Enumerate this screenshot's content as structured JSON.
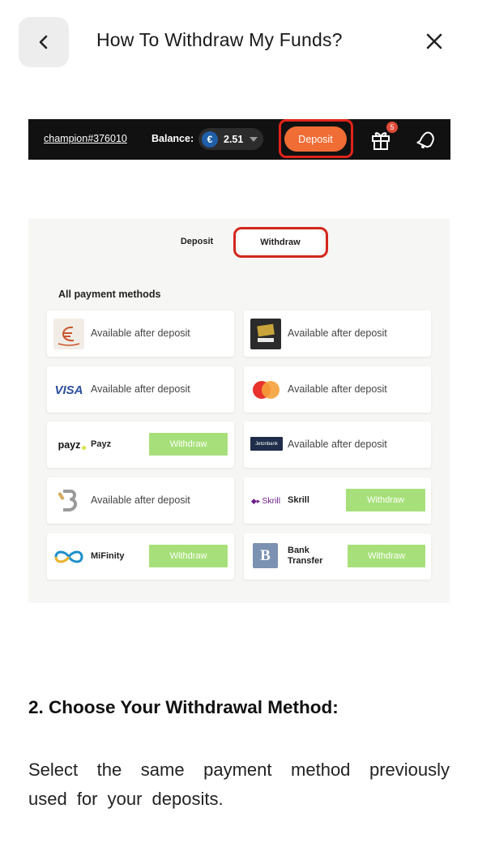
{
  "header": {
    "title": "How To Withdraw My Funds?"
  },
  "site_header": {
    "username": "champion#376010",
    "balance_label": "Balance:",
    "currency_symbol": "€",
    "balance_value": "2.51",
    "deposit_label": "Deposit",
    "gift_badge_count": "5"
  },
  "panel": {
    "tabs": [
      "Deposit",
      "Withdraw"
    ],
    "section_label": "All payment methods",
    "methods": [
      {
        "name": "ecoPayz",
        "status": "Available after deposit"
      },
      {
        "name": "Paysafecard",
        "status": "Available after deposit"
      },
      {
        "name": "Visa",
        "logo_text": "VISA",
        "status": "Available after deposit"
      },
      {
        "name": "Mastercard",
        "status": "Available after deposit"
      },
      {
        "name": "Payz",
        "logo_text": "payz",
        "label": "Payz",
        "action": "Withdraw"
      },
      {
        "name": "Jeton",
        "logo_text": "Jetonbank",
        "status": "Available after deposit"
      },
      {
        "name": "Binance",
        "status": "Available after deposit"
      },
      {
        "name": "Skrill",
        "logo_text": "Skrill",
        "label": "Skrill",
        "action": "Withdraw"
      },
      {
        "name": "MiFinity",
        "label": "MiFinity",
        "action": "Withdraw"
      },
      {
        "name": "Bank Transfer",
        "logo_text": "B",
        "label": "Bank Transfer",
        "action": "Withdraw"
      }
    ]
  },
  "content": {
    "step_heading": "2. Choose Your Withdrawal Method:",
    "step_text": "Select the same payment method previously used for your deposits."
  },
  "colors": {
    "deposit_orange": "#f06d35",
    "highlight_red": "#d3261c",
    "withdraw_green": "#a7e07a"
  }
}
